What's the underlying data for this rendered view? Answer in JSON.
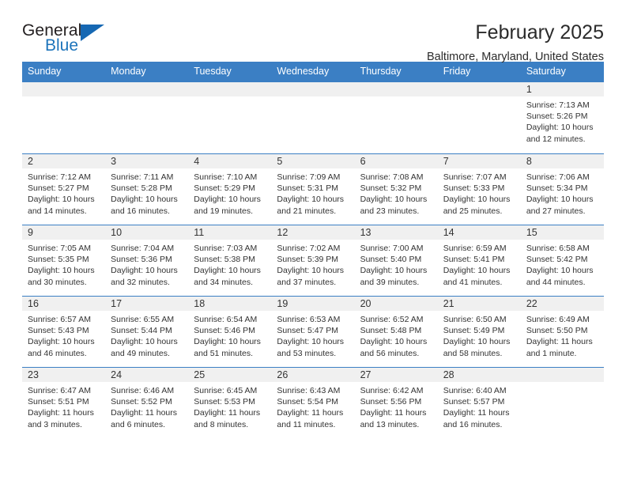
{
  "brand": {
    "word_one": "General",
    "word_two": "Blue",
    "triangle_color": "#1668b3",
    "blue_text_color": "#1d74bb"
  },
  "header": {
    "title": "February 2025",
    "subtitle": "Baltimore, Maryland, United States",
    "header_bg_color": "#3b7fc4",
    "daynum_band_color": "#f0f0f0"
  },
  "weekday_headers": [
    "Sunday",
    "Monday",
    "Tuesday",
    "Wednesday",
    "Thursday",
    "Friday",
    "Saturday"
  ],
  "weeks": [
    [
      {
        "day": "",
        "empty": true
      },
      {
        "day": "",
        "empty": true
      },
      {
        "day": "",
        "empty": true
      },
      {
        "day": "",
        "empty": true
      },
      {
        "day": "",
        "empty": true
      },
      {
        "day": "",
        "empty": true
      },
      {
        "day": "1",
        "sunrise": "Sunrise: 7:13 AM",
        "sunset": "Sunset: 5:26 PM",
        "daylight": "Daylight: 10 hours and 12 minutes."
      }
    ],
    [
      {
        "day": "2",
        "sunrise": "Sunrise: 7:12 AM",
        "sunset": "Sunset: 5:27 PM",
        "daylight": "Daylight: 10 hours and 14 minutes."
      },
      {
        "day": "3",
        "sunrise": "Sunrise: 7:11 AM",
        "sunset": "Sunset: 5:28 PM",
        "daylight": "Daylight: 10 hours and 16 minutes."
      },
      {
        "day": "4",
        "sunrise": "Sunrise: 7:10 AM",
        "sunset": "Sunset: 5:29 PM",
        "daylight": "Daylight: 10 hours and 19 minutes."
      },
      {
        "day": "5",
        "sunrise": "Sunrise: 7:09 AM",
        "sunset": "Sunset: 5:31 PM",
        "daylight": "Daylight: 10 hours and 21 minutes."
      },
      {
        "day": "6",
        "sunrise": "Sunrise: 7:08 AM",
        "sunset": "Sunset: 5:32 PM",
        "daylight": "Daylight: 10 hours and 23 minutes."
      },
      {
        "day": "7",
        "sunrise": "Sunrise: 7:07 AM",
        "sunset": "Sunset: 5:33 PM",
        "daylight": "Daylight: 10 hours and 25 minutes."
      },
      {
        "day": "8",
        "sunrise": "Sunrise: 7:06 AM",
        "sunset": "Sunset: 5:34 PM",
        "daylight": "Daylight: 10 hours and 27 minutes."
      }
    ],
    [
      {
        "day": "9",
        "sunrise": "Sunrise: 7:05 AM",
        "sunset": "Sunset: 5:35 PM",
        "daylight": "Daylight: 10 hours and 30 minutes."
      },
      {
        "day": "10",
        "sunrise": "Sunrise: 7:04 AM",
        "sunset": "Sunset: 5:36 PM",
        "daylight": "Daylight: 10 hours and 32 minutes."
      },
      {
        "day": "11",
        "sunrise": "Sunrise: 7:03 AM",
        "sunset": "Sunset: 5:38 PM",
        "daylight": "Daylight: 10 hours and 34 minutes."
      },
      {
        "day": "12",
        "sunrise": "Sunrise: 7:02 AM",
        "sunset": "Sunset: 5:39 PM",
        "daylight": "Daylight: 10 hours and 37 minutes."
      },
      {
        "day": "13",
        "sunrise": "Sunrise: 7:00 AM",
        "sunset": "Sunset: 5:40 PM",
        "daylight": "Daylight: 10 hours and 39 minutes."
      },
      {
        "day": "14",
        "sunrise": "Sunrise: 6:59 AM",
        "sunset": "Sunset: 5:41 PM",
        "daylight": "Daylight: 10 hours and 41 minutes."
      },
      {
        "day": "15",
        "sunrise": "Sunrise: 6:58 AM",
        "sunset": "Sunset: 5:42 PM",
        "daylight": "Daylight: 10 hours and 44 minutes."
      }
    ],
    [
      {
        "day": "16",
        "sunrise": "Sunrise: 6:57 AM",
        "sunset": "Sunset: 5:43 PM",
        "daylight": "Daylight: 10 hours and 46 minutes."
      },
      {
        "day": "17",
        "sunrise": "Sunrise: 6:55 AM",
        "sunset": "Sunset: 5:44 PM",
        "daylight": "Daylight: 10 hours and 49 minutes."
      },
      {
        "day": "18",
        "sunrise": "Sunrise: 6:54 AM",
        "sunset": "Sunset: 5:46 PM",
        "daylight": "Daylight: 10 hours and 51 minutes."
      },
      {
        "day": "19",
        "sunrise": "Sunrise: 6:53 AM",
        "sunset": "Sunset: 5:47 PM",
        "daylight": "Daylight: 10 hours and 53 minutes."
      },
      {
        "day": "20",
        "sunrise": "Sunrise: 6:52 AM",
        "sunset": "Sunset: 5:48 PM",
        "daylight": "Daylight: 10 hours and 56 minutes."
      },
      {
        "day": "21",
        "sunrise": "Sunrise: 6:50 AM",
        "sunset": "Sunset: 5:49 PM",
        "daylight": "Daylight: 10 hours and 58 minutes."
      },
      {
        "day": "22",
        "sunrise": "Sunrise: 6:49 AM",
        "sunset": "Sunset: 5:50 PM",
        "daylight": "Daylight: 11 hours and 1 minute."
      }
    ],
    [
      {
        "day": "23",
        "sunrise": "Sunrise: 6:47 AM",
        "sunset": "Sunset: 5:51 PM",
        "daylight": "Daylight: 11 hours and 3 minutes."
      },
      {
        "day": "24",
        "sunrise": "Sunrise: 6:46 AM",
        "sunset": "Sunset: 5:52 PM",
        "daylight": "Daylight: 11 hours and 6 minutes."
      },
      {
        "day": "25",
        "sunrise": "Sunrise: 6:45 AM",
        "sunset": "Sunset: 5:53 PM",
        "daylight": "Daylight: 11 hours and 8 minutes."
      },
      {
        "day": "26",
        "sunrise": "Sunrise: 6:43 AM",
        "sunset": "Sunset: 5:54 PM",
        "daylight": "Daylight: 11 hours and 11 minutes."
      },
      {
        "day": "27",
        "sunrise": "Sunrise: 6:42 AM",
        "sunset": "Sunset: 5:56 PM",
        "daylight": "Daylight: 11 hours and 13 minutes."
      },
      {
        "day": "28",
        "sunrise": "Sunrise: 6:40 AM",
        "sunset": "Sunset: 5:57 PM",
        "daylight": "Daylight: 11 hours and 16 minutes."
      },
      {
        "day": "",
        "empty": true
      }
    ]
  ]
}
